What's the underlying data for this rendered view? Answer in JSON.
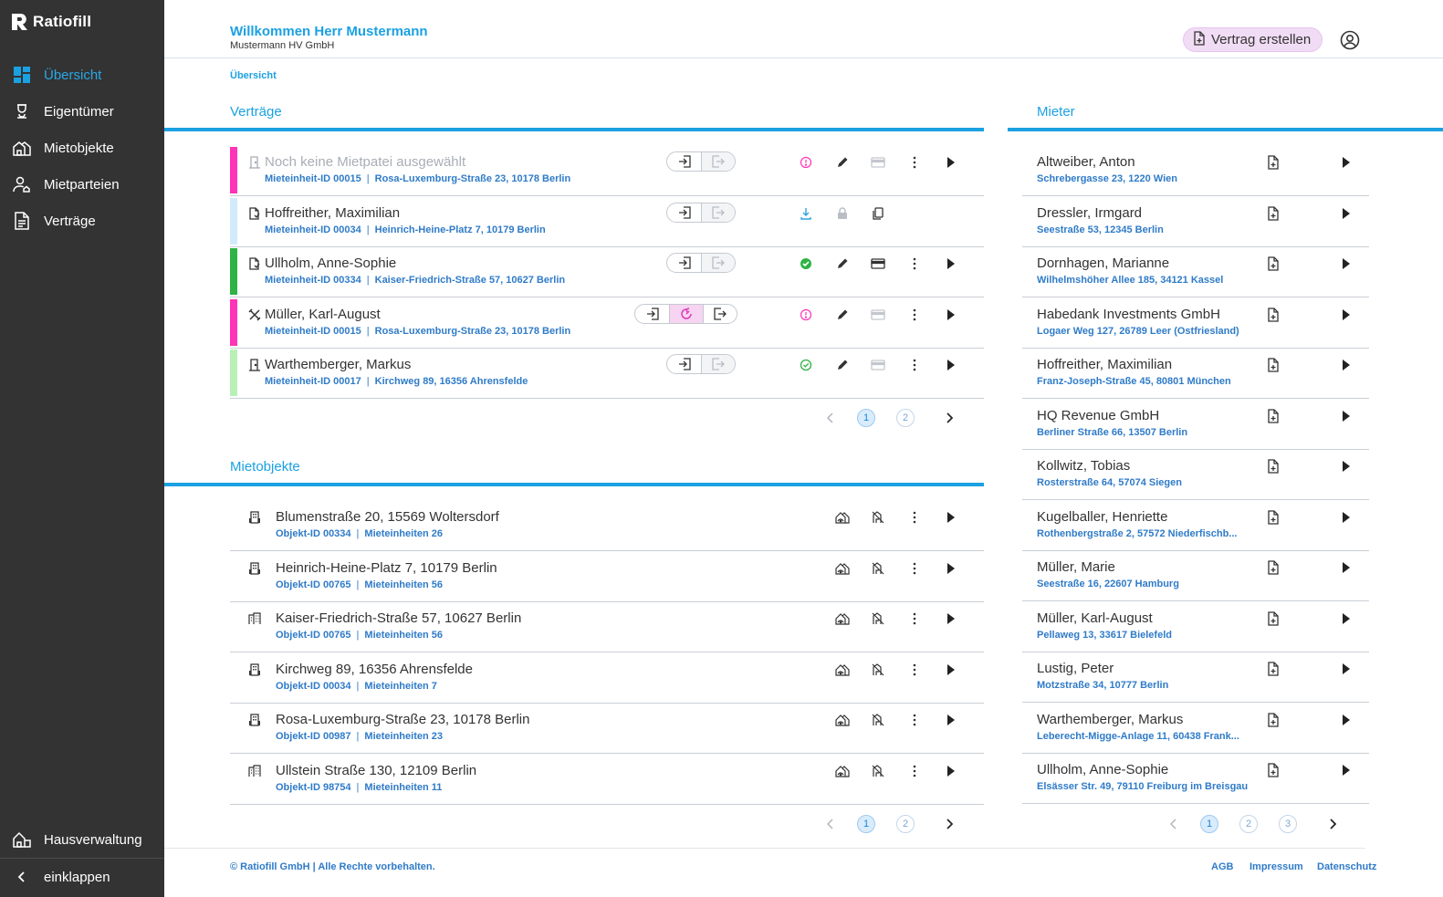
{
  "app": {
    "name": "Ratiofill"
  },
  "colors": {
    "accent": "#1ba1e2",
    "sidebar": "#333333",
    "pink": "#ff33b5",
    "lightblue": "#d2ebfa",
    "green": "#2fb344",
    "lightgreen": "#b8f0b8"
  },
  "sidebar": {
    "items": [
      {
        "label": "Übersicht",
        "icon": "dashboard-icon",
        "active": true
      },
      {
        "label": "Eigentümer",
        "icon": "owner-icon",
        "active": false
      },
      {
        "label": "Mietobjekte",
        "icon": "house-icon",
        "active": false
      },
      {
        "label": "Mietparteien",
        "icon": "tenant-icon",
        "active": false
      },
      {
        "label": "Verträge",
        "icon": "document-icon",
        "active": false
      }
    ],
    "bottom": [
      {
        "label": "Hausverwaltung",
        "icon": "building-icon"
      },
      {
        "label": "einklappen",
        "icon": "chevron-left-icon"
      }
    ]
  },
  "header": {
    "welcome": "Willkommen Herr Mustermann",
    "company": "Mustermann HV GmbH",
    "create_label": "Vertrag erstellen"
  },
  "breadcrumb": "Übersicht",
  "contracts": {
    "title": "Verträge",
    "rows": [
      {
        "name": "Noch keine Mietpatei ausgewählt",
        "unit": "Mieteinheit-ID 00015",
        "address": "Rosa-Luxemburg-Straße 23, 10178 Berlin",
        "stripe": "#ff33b5",
        "icon": "door-icon",
        "muted": true,
        "status": "warning",
        "pill3": false,
        "active_seg": -1,
        "actions": "full",
        "payment_active": false
      },
      {
        "name": "Hoffreither, Maximilian",
        "unit": "Mieteinheit-ID 00034",
        "address": "Heinrich-Heine-Platz 7, 10179 Berlin",
        "stripe": "#d2ebfa",
        "icon": "contract-icon",
        "muted": false,
        "status": "download",
        "pill3": false,
        "active_seg": -1,
        "actions": "locked",
        "payment_active": false
      },
      {
        "name": "Ullholm, Anne-Sophie",
        "unit": "Mieteinheit-ID 00334",
        "address": "Kaiser-Friedrich-Straße 57, 10627 Berlin",
        "stripe": "#2fb344",
        "icon": "contract-icon",
        "muted": false,
        "status": "ok-filled",
        "pill3": false,
        "active_seg": -1,
        "actions": "full",
        "payment_active": true
      },
      {
        "name": "Müller, Karl-August",
        "unit": "Mieteinheit-ID 00015",
        "address": "Rosa-Luxemburg-Straße 23, 10178 Berlin",
        "stripe": "#ff33b5",
        "icon": "tools-icon",
        "muted": false,
        "status": "warning",
        "pill3": true,
        "active_seg": 1,
        "actions": "full",
        "payment_active": false
      },
      {
        "name": "Warthemberger, Markus",
        "unit": "Mieteinheit-ID 00017",
        "address": "Kirchweg 89, 16356 Ahrensfelde",
        "stripe": "#b8f0b8",
        "icon": "door-icon",
        "muted": false,
        "status": "ok-outline",
        "pill3": false,
        "active_seg": -1,
        "actions": "full",
        "payment_active": false
      }
    ],
    "pages": [
      "1",
      "2"
    ]
  },
  "properties": {
    "title": "Mietobjekte",
    "rows": [
      {
        "address": "Blumenstraße 20, 15569 Woltersdorf",
        "object_id": "Objekt-ID 00334",
        "units": "Mieteinheiten 26",
        "icon": "apartment-building-icon"
      },
      {
        "address": "Heinrich-Heine-Platz 7, 10179 Berlin",
        "object_id": "Objekt-ID 00765",
        "units": "Mieteinheiten 56",
        "icon": "apartment-building-icon"
      },
      {
        "address": "Kaiser-Friedrich-Straße 57, 10627 Berlin",
        "object_id": "Objekt-ID 00765",
        "units": "Mieteinheiten 56",
        "icon": "office-building-icon"
      },
      {
        "address": "Kirchweg 89, 16356 Ahrensfelde",
        "object_id": "Objekt-ID 00034",
        "units": "Mieteinheiten 7",
        "icon": "apartment-building-icon"
      },
      {
        "address": "Rosa-Luxemburg-Straße 23, 10178 Berlin",
        "object_id": "Objekt-ID 00987",
        "units": "Mieteinheiten 23",
        "icon": "apartment-building-icon"
      },
      {
        "address": "Ullstein Straße 130, 12109 Berlin",
        "object_id": "Objekt-ID 98754",
        "units": "Mieteinheiten 11",
        "icon": "office-building-icon"
      }
    ],
    "pages": [
      "1",
      "2"
    ]
  },
  "tenants": {
    "title": "Mieter",
    "rows": [
      {
        "name": "Altweiber, Anton",
        "address": "Schrebergasse 23, 1220 Wien"
      },
      {
        "name": "Dressler, Irmgard",
        "address": "Seestraße 53, 12345 Berlin"
      },
      {
        "name": "Dornhagen, Marianne",
        "address": "Wilhelmshöher Allee 185, 34121 Kassel"
      },
      {
        "name": "Habedank Investments GmbH",
        "address": "Logaer Weg 127, 26789 Leer (Ostfriesland)"
      },
      {
        "name": "Hoffreither, Maximilian",
        "address": "Franz-Joseph-Straße 45, 80801 München"
      },
      {
        "name": "HQ Revenue GmbH",
        "address": "Berliner Straße 66, 13507 Berlin"
      },
      {
        "name": "Kollwitz, Tobias",
        "address": "Rosterstraße 64, 57074 Siegen"
      },
      {
        "name": "Kugelballer, Henriette",
        "address": "Rothenbergstraße 2, 57572 Niederfischb..."
      },
      {
        "name": "Müller, Marie",
        "address": "Seestraße 16, 22607 Hamburg"
      },
      {
        "name": "Müller, Karl-August",
        "address": "Pellaweg 13, 33617 Bielefeld"
      },
      {
        "name": "Lustig, Peter",
        "address": "Motzstraße 34, 10777 Berlin"
      },
      {
        "name": "Warthemberger, Markus",
        "address": "Leberecht-Migge-Anlage 11, 60438 Frank..."
      },
      {
        "name": "Ullholm, Anne-Sophie",
        "address": "Elsässer Str. 49, 79110 Freiburg im Breisgau"
      }
    ],
    "pages": [
      "1",
      "2",
      "3"
    ]
  },
  "footer": {
    "copyright": "© Ratiofill GmbH | Alle Rechte vorbehalten.",
    "links": [
      "AGB",
      "Impressum",
      "Datenschutz"
    ]
  }
}
